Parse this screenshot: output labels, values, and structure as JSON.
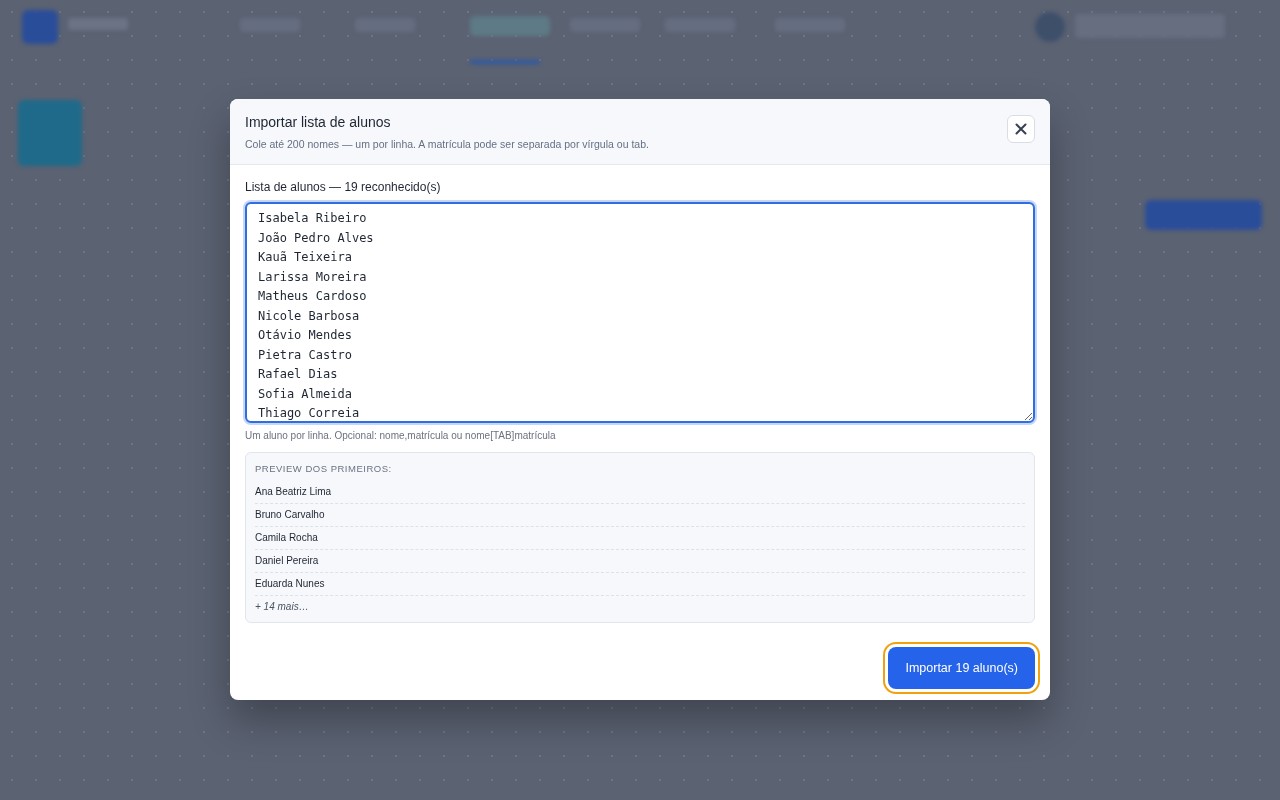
{
  "dialog": {
    "title": "Importar lista de alunos",
    "subtitle": "Cole até 200 nomes — um por linha. A matrícula pode ser separada por vírgula ou tab.",
    "field_label": "Lista de alunos — 19 reconhecido(s)",
    "names_field": {
      "value": "Isabela Ribeiro\nJoão Pedro Alves\nKauã Teixeira\nLarissa Moreira\nMatheus Cardoso\nNicole Barbosa\nOtávio Mendes\nPietra Castro\nRafael Dias\nSofia Almeida\nThiago Correia"
    },
    "hint": "Um aluno por linha. Opcional: nome,matrícula ou nome[TAB]matrícula",
    "preview": {
      "title": "PREVIEW DOS PRIMEIROS:",
      "items": [
        "Ana Beatriz Lima",
        "Bruno Carvalho",
        "Camila Rocha",
        "Daniel Pereira",
        "Eduarda Nunes"
      ],
      "more": "+ 14 mais…"
    },
    "import_button": {
      "label": "Importar 19 aluno(s)",
      "focused": true
    }
  }
}
